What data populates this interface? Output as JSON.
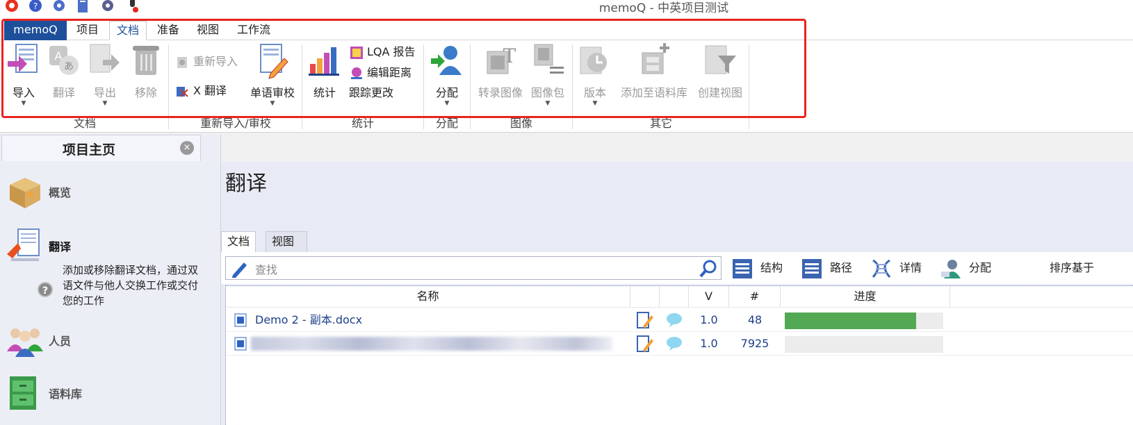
{
  "window": {
    "title": "memoQ - 中英项目测试"
  },
  "ribbon": {
    "tabs": [
      {
        "label": "memoQ"
      },
      {
        "label": "项目"
      },
      {
        "label": "文档"
      },
      {
        "label": "准备"
      },
      {
        "label": "视图"
      },
      {
        "label": "工作流"
      }
    ],
    "groups": {
      "document": {
        "label": "文档",
        "import": "导入",
        "translate": "翻译",
        "export": "导出",
        "remove": "移除"
      },
      "reimport_review": {
        "label": "重新导入/审校",
        "reimport": "重新导入",
        "x_translate": "X 翻译",
        "monolingual_review": "单语审校"
      },
      "statistics": {
        "label": "统计",
        "stats": "统计",
        "lqa_report": "LQA 报告",
        "edit_distance": "编辑距离",
        "track_changes": "跟踪更改"
      },
      "assign": {
        "label": "分配",
        "assign": "分配"
      },
      "image": {
        "label": "图像",
        "transcribe_image": "转录图像",
        "image_pack": "图像包"
      },
      "other": {
        "label": "其它",
        "version": "版本",
        "add_to_corpus": "添加至语料库",
        "create_view": "创建视图"
      }
    }
  },
  "left_panel": {
    "title": "项目主页",
    "items": [
      {
        "label": "概览"
      },
      {
        "label": "翻译"
      },
      {
        "label": "人员"
      },
      {
        "label": "语料库"
      }
    ],
    "description": "添加或移除翻译文档，通过双语文件与他人交换工作或交付您的工作",
    "help_glyph": "?",
    "close_glyph": "×"
  },
  "main": {
    "title": "翻译",
    "subtabs": [
      {
        "label": "文档"
      },
      {
        "label": "视图"
      }
    ],
    "search_placeholder": "查找",
    "toolbar": {
      "structure": "结构",
      "path": "路径",
      "details": "详情",
      "assign": "分配",
      "sort": "排序基于"
    },
    "columns": {
      "name": "名称",
      "v": "V",
      "count": "#",
      "progress": "进度"
    },
    "rows": [
      {
        "name": "Demo 2 - 副本.docx",
        "v": "1.0",
        "count": "48",
        "progress": 0.83
      },
      {
        "name": "",
        "v": "1.0",
        "count": "7925",
        "progress": 0
      }
    ]
  },
  "colors": {
    "memoq_blue": "#1e4f9b",
    "highlight_red": "#e8231e",
    "progress_green": "#53a854",
    "link_blue": "#1e3f8a"
  },
  "icons": [
    "import-icon",
    "translate-icon",
    "export-icon",
    "remove-icon",
    "reimport-icon",
    "x-translate-icon",
    "review-icon",
    "statistics-icon",
    "lqa-icon",
    "edit-distance-icon",
    "assign-icon",
    "transcribe-image-icon",
    "image-pack-icon",
    "version-icon",
    "corpus-icon",
    "create-view-icon",
    "search-icon",
    "structure-icon",
    "path-icon",
    "details-icon",
    "assign-user-icon",
    "word-doc-icon",
    "edit-icon",
    "comment-icon"
  ]
}
